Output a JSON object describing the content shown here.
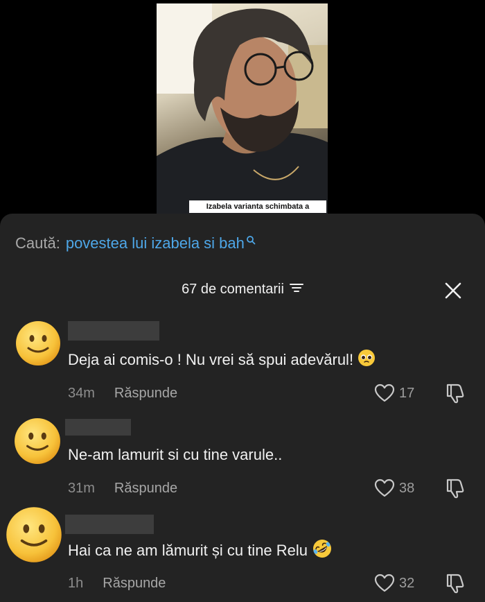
{
  "video": {
    "caption": "Izabela varianta schimbata a"
  },
  "search": {
    "prefix": "Caută:",
    "query": "povestea lui izabela si bah"
  },
  "comments_header": {
    "count_label": "67 de comentarii"
  },
  "comments": [
    {
      "text": "Deja ai comis-o ! Nu vrei să spui adevărul!",
      "emoji": "pleading-face",
      "time": "34m",
      "reply_label": "Răspunde",
      "likes": "17"
    },
    {
      "text": "Ne-am lamurit si cu tine varule..",
      "time": "31m",
      "reply_label": "Răspunde",
      "likes": "38"
    },
    {
      "text": "Hai ca ne am lămurit și cu tine Relu",
      "emoji": "rolling-on-floor-laughing",
      "time": "1h",
      "reply_label": "Răspunde",
      "likes": "32"
    }
  ],
  "colors": {
    "sheet_bg": "#232323",
    "search_query": "#4ea7e8",
    "text_primary": "#f1f1f1",
    "text_secondary": "#8d8d8d"
  }
}
